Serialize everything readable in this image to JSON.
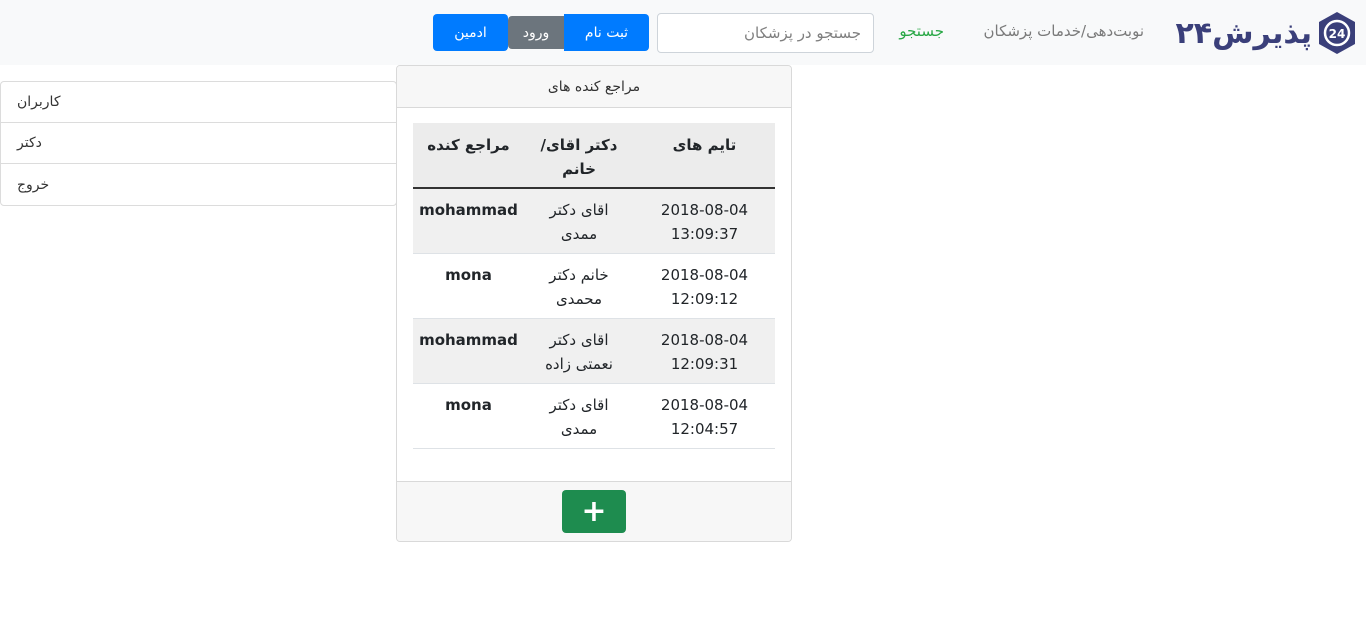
{
  "navbar": {
    "brand_text": "پذیرش۲۴",
    "brand_badge": "24",
    "services_link": "نوبت‌دهی/خدمات پزشکان",
    "search_link": "جستجو",
    "search_placeholder": "جستجو در پزشکان",
    "register_label": "ثبت نام",
    "login_label": "ورود",
    "admin_label": "ادمین"
  },
  "sidebar": {
    "items": [
      {
        "label": "کاربران"
      },
      {
        "label": "دکتر"
      },
      {
        "label": "خروج"
      }
    ]
  },
  "card": {
    "header": "مراجع کنده های",
    "add_label": "+",
    "table": {
      "columns": [
        "مراجع کنده",
        "دکتر اقای/ خانم",
        "تایم های"
      ],
      "rows": [
        {
          "patient": "mohammad",
          "doctor": "اقای دکتر ممدی",
          "date": "2018-08-04",
          "time": "13:09:37"
        },
        {
          "patient": "mona",
          "doctor": "خانم دکتر محمدی",
          "date": "2018-08-04",
          "time": "12:09:12"
        },
        {
          "patient": "mohammad",
          "doctor": "اقای دکتر نعمتی زاده",
          "date": "2018-08-04",
          "time": "12:09:31"
        },
        {
          "patient": "mona",
          "doctor": "اقای دکتر ممدی",
          "date": "2018-08-04",
          "time": "12:04:57"
        }
      ]
    }
  }
}
